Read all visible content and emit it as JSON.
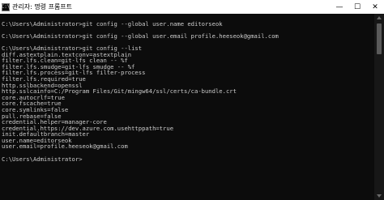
{
  "window": {
    "title": "관리자: 명령 프롬프트",
    "icon_glyph": "C:\\",
    "controls": {
      "minimize": "—",
      "maximize": "☐",
      "close": "✕"
    }
  },
  "terminal": {
    "lines": [
      "",
      "C:\\Users\\Administrator>git config --global user.name editorseok",
      "",
      "C:\\Users\\Administrator>git config --global user.email profile.heeseok@gmail.com",
      "",
      "C:\\Users\\Administrator>git config --list",
      "diff.astextplain.textconv=astextplain",
      "filter.lfs.clean=git-lfs clean -- %f",
      "filter.lfs.smudge=git-lfs smudge -- %f",
      "filter.lfs.process=git-lfs filter-process",
      "filter.lfs.required=true",
      "http.sslbackend=openssl",
      "http.sslcainfo=C:/Program Files/Git/mingw64/ssl/certs/ca-bundle.crt",
      "core.autocrlf=true",
      "core.fscache=true",
      "core.symlinks=false",
      "pull.rebase=false",
      "credential.helper=manager-core",
      "credential.https://dev.azure.com.usehttppath=true",
      "init.defaultbranch=master",
      "user.name=editorseok",
      "user.email=profile.heeseok@gmail.com",
      "",
      "C:\\Users\\Administrator>"
    ]
  },
  "colors": {
    "background": "#0c0c0c",
    "text": "#cccccc",
    "titlebar": "#ffffff"
  }
}
